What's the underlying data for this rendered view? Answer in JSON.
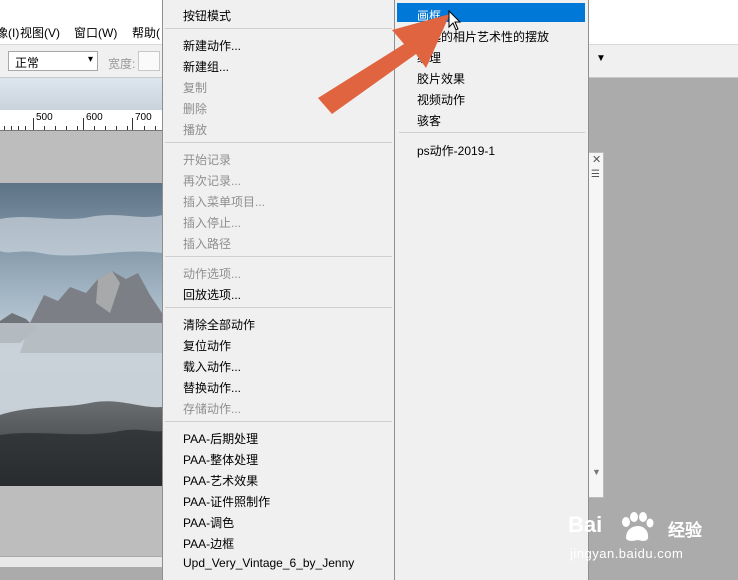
{
  "menubar": {
    "items": [
      {
        "label": "像(I)"
      },
      {
        "label": "视图(V)"
      },
      {
        "label": "窗口(W)"
      },
      {
        "label": "帮助("
      }
    ]
  },
  "options_bar": {
    "mode_value": "正常",
    "width_label": "宽度:"
  },
  "ruler": {
    "ticks": [
      "500",
      "600",
      "700"
    ]
  },
  "actions_menu": {
    "items": [
      {
        "label": "按钮模式",
        "enabled": true
      },
      {
        "label": "新建动作...",
        "enabled": true
      },
      {
        "label": "新建组...",
        "enabled": true
      },
      {
        "label": "复制",
        "enabled": false
      },
      {
        "label": "删除",
        "enabled": false
      },
      {
        "label": "播放",
        "enabled": false
      },
      {
        "label": "开始记录",
        "enabled": false
      },
      {
        "label": "再次记录...",
        "enabled": false
      },
      {
        "label": "插入菜单项目...",
        "enabled": false
      },
      {
        "label": "插入停止...",
        "enabled": false
      },
      {
        "label": "插入路径",
        "enabled": false
      },
      {
        "label": "动作选项...",
        "enabled": false
      },
      {
        "label": "回放选项...",
        "enabled": true
      },
      {
        "label": "清除全部动作",
        "enabled": true
      },
      {
        "label": "复位动作",
        "enabled": true
      },
      {
        "label": "载入动作...",
        "enabled": true
      },
      {
        "label": "替换动作...",
        "enabled": true
      },
      {
        "label": "存储动作...",
        "enabled": false
      },
      {
        "label": "PAA-后期处理",
        "enabled": true
      },
      {
        "label": "PAA-整体处理",
        "enabled": true
      },
      {
        "label": "PAA-艺术效果",
        "enabled": true
      },
      {
        "label": "PAA-证件照制作",
        "enabled": true
      },
      {
        "label": "PAA-调色",
        "enabled": true
      },
      {
        "label": "PAA-边框",
        "enabled": true
      },
      {
        "label": "Upd_Very_Vintage_6_by_Jenny",
        "enabled": true
      }
    ]
  },
  "sub_menu": {
    "items": [
      {
        "label": "画框",
        "selected": true
      },
      {
        "label": "精选的相片艺术性的摆放"
      },
      {
        "label": "纹理"
      },
      {
        "label": "胶片效果"
      },
      {
        "label": "视频动作"
      },
      {
        "label": "骇客"
      },
      {
        "label": "ps动作-2019-1"
      }
    ]
  },
  "watermark": {
    "brand": "Bai",
    "cn": "经验",
    "url": "jingyan.baidu.com"
  },
  "colors": {
    "highlight": "#0078d7",
    "annotation_arrow": "#e0643f",
    "menu_bg": "#f0f0f0"
  },
  "icons": [
    "chevron-down-icon",
    "submenu-arrow-icon",
    "close-icon",
    "panel-menu-icon",
    "mouse-cursor-icon",
    "annotation-arrow-icon",
    "baidu-paw-icon"
  ]
}
